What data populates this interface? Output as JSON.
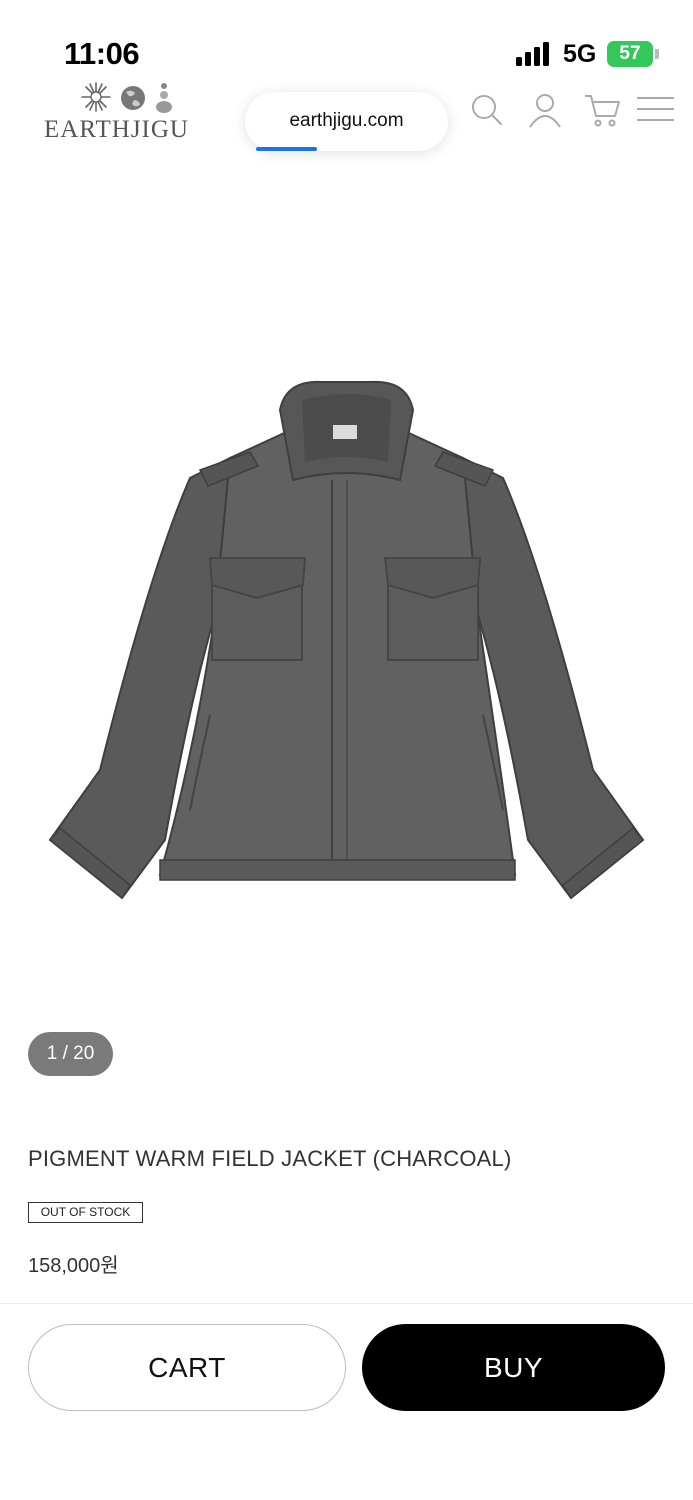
{
  "status_bar": {
    "time": "11:06",
    "network": "5G",
    "battery": "57",
    "battery_color": "#34c759"
  },
  "header": {
    "logo_text": "EARTHJIGU",
    "url": "earthjigu.com",
    "icons": [
      "search-icon",
      "user-icon",
      "cart-icon",
      "menu-icon"
    ]
  },
  "product": {
    "image_counter": "1 / 20",
    "title": "PIGMENT WARM FIELD JACKET (CHARCOAL)",
    "stock_status": "OUT OF STOCK",
    "price": "158,000원"
  },
  "actions": {
    "cart_label": "CART",
    "buy_label": "BUY"
  }
}
